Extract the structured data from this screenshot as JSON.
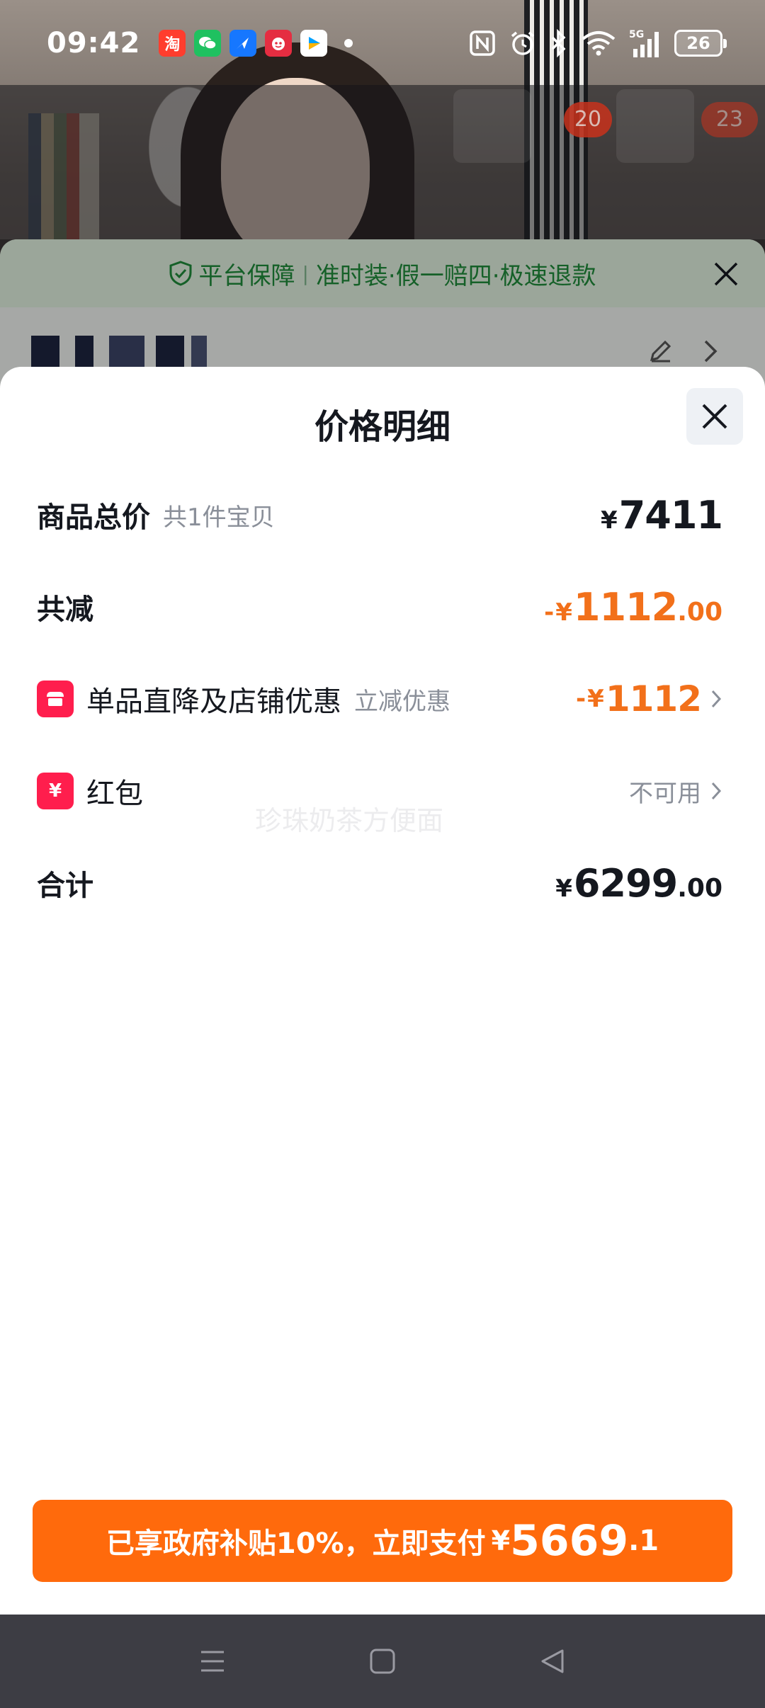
{
  "status_bar": {
    "time": "09:42",
    "apps": [
      {
        "name": "taobao-icon",
        "glyph": "淘",
        "color": "#ff3d2e"
      },
      {
        "name": "wechat-icon",
        "glyph": "💬",
        "color": "#1fc160"
      },
      {
        "name": "alipay-icon",
        "glyph": "✈",
        "color": "#1677ff"
      },
      {
        "name": "pinduoduo-icon",
        "glyph": "拼",
        "color": "#e52d41"
      },
      {
        "name": "video-icon",
        "glyph": "▶",
        "color": "#00a1ff"
      }
    ],
    "network": "5G",
    "battery": "26"
  },
  "background": {
    "badge_1": "20",
    "badge_2": "23"
  },
  "guarantee": {
    "label": "平台保障",
    "separator": "|",
    "text": "准时装·假一赔四·极速退款"
  },
  "price_sheet": {
    "title": "价格明细",
    "rows": {
      "goods_total": {
        "label": "商品总价",
        "sub": "共1件宝贝",
        "currency": "¥",
        "amount": "7411"
      },
      "total_discount": {
        "label": "共减",
        "prefix": "-",
        "currency": "¥",
        "amount": "1112",
        "decimal": ".00"
      },
      "store_discount": {
        "label": "单品直降及店铺优惠",
        "sub": "立减优惠",
        "prefix": "-",
        "currency": "¥",
        "amount": "1112"
      },
      "red_packet": {
        "label": "红包",
        "icon_glyph": "¥",
        "value": "不可用"
      },
      "sum": {
        "label": "合计",
        "currency": "¥",
        "amount": "6299",
        "decimal": ".00"
      }
    },
    "watermark": "珍珠奶茶方便面"
  },
  "pay_button": {
    "text": "已享政府补贴10%，立即支付",
    "currency": "¥",
    "amount": "5669",
    "decimal": ".1"
  },
  "colors": {
    "accent_orange": "#ff6a0c",
    "discount_orange": "#f2701a",
    "guarantee_green": "#1f8a3a",
    "icon_red": "#ff1e4d"
  }
}
